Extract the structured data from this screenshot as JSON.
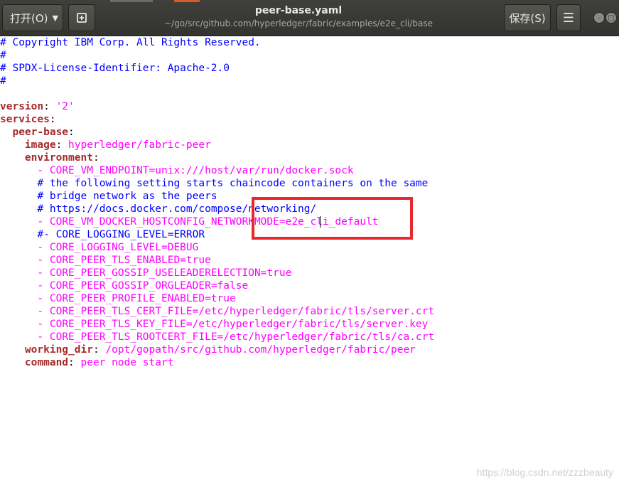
{
  "header": {
    "open_label": "打开(O)",
    "title": "peer-base.yaml",
    "subtitle": "~/go/src/github.com/hyperledger/fabric/examples/e2e_cli/base",
    "save_label": "保存(S)",
    "menu_icon": "hamburger-menu-icon",
    "new_icon": "new-document-icon"
  },
  "code": {
    "l1": "# Copyright IBM Corp. All Rights Reserved.",
    "l2": "#",
    "l3": "# SPDX-License-Identifier: Apache-2.0",
    "l4": "#",
    "version_key": "version",
    "version_val": "'2'",
    "services_key": "services",
    "peerbase_key": "peer-base",
    "image_key": "image",
    "image_val": "hyperledger/fabric-peer",
    "env_key": "environment",
    "e1": "CORE_VM_ENDPOINT=unix:///host/var/run/docker.sock",
    "c1": "# the following setting starts chaincode containers on the same",
    "c2": "# bridge network as the peers",
    "c3": "# https://docs.docker.com/compose/networking/",
    "e2": "CORE_VM_DOCKER_HOSTCONFIG_NETWORKMODE=e2e_cli_default",
    "c4": "#- CORE_LOGGING_LEVEL=ERROR",
    "e3": "CORE_LOGGING_LEVEL=DEBUG",
    "e4": "CORE_PEER_TLS_ENABLED=true",
    "e5": "CORE_PEER_GOSSIP_USELEADERELECTION=true",
    "e6": "CORE_PEER_GOSSIP_ORGLEADER=false",
    "e7": "CORE_PEER_PROFILE_ENABLED=true",
    "e8": "CORE_PEER_TLS_CERT_FILE=/etc/hyperledger/fabric/tls/server.crt",
    "e9": "CORE_PEER_TLS_KEY_FILE=/etc/hyperledger/fabric/tls/server.key",
    "e10": "CORE_PEER_TLS_ROOTCERT_FILE=/etc/hyperledger/fabric/tls/ca.crt",
    "wd_key": "working_dir",
    "wd_val": "/opt/gopath/src/github.com/hyperledger/fabric/peer",
    "cmd_key": "command",
    "cmd_val": "peer node start"
  },
  "watermark": "https://blog.csdn.net/zzzbeauty",
  "colors": {
    "key": "#a52a2a",
    "comment": "#0000ff",
    "string": "#ff00ff",
    "highlight": "#e8282a"
  }
}
